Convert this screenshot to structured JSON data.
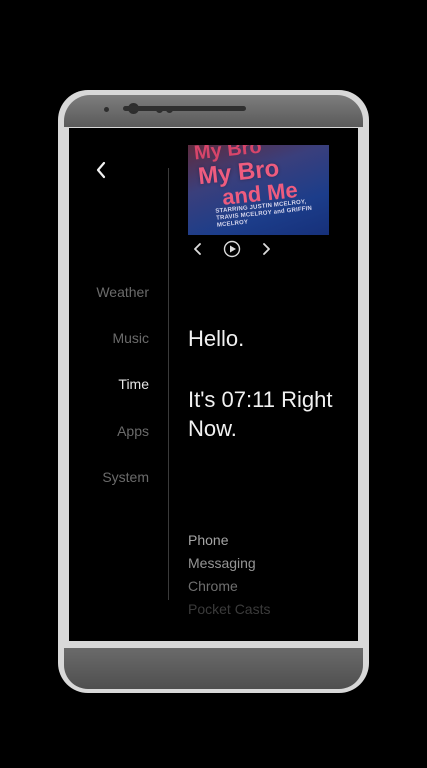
{
  "nav": {
    "back_icon": "chevron-left-icon",
    "items": [
      {
        "label": "Weather",
        "active": false
      },
      {
        "label": "Music",
        "active": false
      },
      {
        "label": "Time",
        "active": true
      },
      {
        "label": "Apps",
        "active": false
      },
      {
        "label": "System",
        "active": false
      }
    ]
  },
  "music": {
    "album_art_lines": [
      "My Bro",
      "My Bro",
      "and Me"
    ],
    "album_art_credits": "STARRING JUSTIN MCELROY, TRAVIS MCELROY and GRIFFIN MCELROY",
    "controls": [
      "previous-icon",
      "play-icon",
      "next-icon"
    ]
  },
  "time": {
    "greeting": "Hello.",
    "time_line": "It's 07:11 Right Now."
  },
  "apps": [
    "Phone",
    "Messaging",
    "Chrome",
    "Pocket Casts"
  ],
  "colors": {
    "background": "#000000",
    "active_text": "#e6e6e6",
    "inactive_text": "#6b6b6b",
    "phone_frame": "#d8d8d8"
  }
}
